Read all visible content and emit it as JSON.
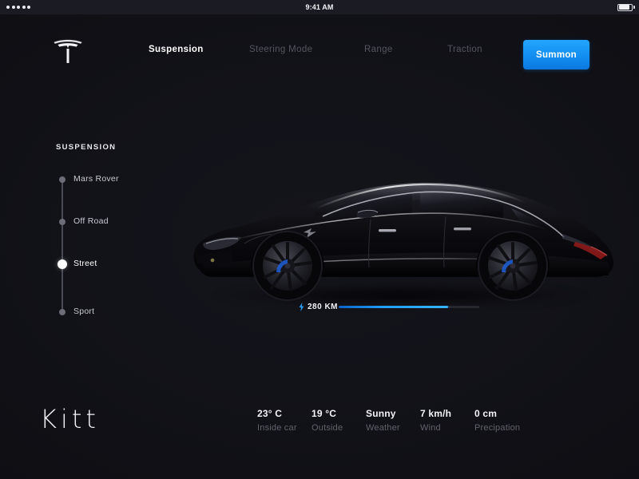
{
  "statusbar": {
    "signal_dots": 5,
    "time": "9:41 AM",
    "battery_level_pct": 85
  },
  "nav": {
    "logo_icon": "tesla-logo-icon",
    "items": [
      {
        "label": "Suspension",
        "active": true
      },
      {
        "label": "Steering Mode",
        "active": false
      },
      {
        "label": "Range",
        "active": false
      },
      {
        "label": "Traction",
        "active": false
      }
    ],
    "summon_label": "Summon",
    "accent_color": "#1490f2"
  },
  "suspension": {
    "title": "SUSPENSION",
    "options": [
      {
        "label": "Mars Rover",
        "selected": false
      },
      {
        "label": "Off Road",
        "selected": false
      },
      {
        "label": "Street",
        "selected": true
      },
      {
        "label": "Sport",
        "selected": false
      }
    ]
  },
  "range": {
    "icon": "lightning-bolt-icon",
    "value": "280 KM",
    "fill_pct": 78,
    "fill_color": "#1f9dfb"
  },
  "vehicle": {
    "image_alt": "tesla-model-s-side-view",
    "body_color": "#0b0b0e"
  },
  "footer": {
    "brand": "Kitt",
    "stats": [
      {
        "value": "23° C",
        "label": "Inside car"
      },
      {
        "value": "19 °C",
        "label": "Outside"
      },
      {
        "value": "Sunny",
        "label": "Weather"
      },
      {
        "value": "7 km/h",
        "label": "Wind"
      },
      {
        "value": "0 cm",
        "label": "Precipation"
      }
    ]
  }
}
